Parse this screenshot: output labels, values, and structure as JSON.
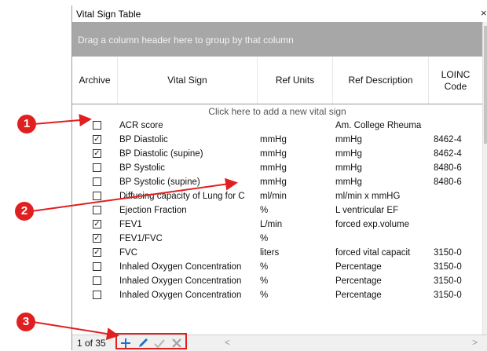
{
  "window": {
    "title": "Vital Sign Table",
    "close_glyph": "×"
  },
  "group_area": {
    "text": "Drag a column header here to group by that column"
  },
  "columns": [
    "Archive",
    "Vital Sign",
    "Ref Units",
    "Ref Description",
    "LOINC\nCode"
  ],
  "add_row_text": "Click here to add a new vital sign",
  "rows": [
    {
      "checked": false,
      "name": "ACR score",
      "units": "",
      "desc": "Am. College Rheuma",
      "loinc": ""
    },
    {
      "checked": true,
      "name": "BP Diastolic",
      "units": "mmHg",
      "desc": "mmHg",
      "loinc": "8462-4"
    },
    {
      "checked": true,
      "name": "BP Diastolic (supine)",
      "units": "mmHg",
      "desc": "mmHg",
      "loinc": "8462-4"
    },
    {
      "checked": false,
      "name": "BP Systolic",
      "units": "mmHg",
      "desc": "mmHg",
      "loinc": "8480-6"
    },
    {
      "checked": false,
      "name": "BP Systolic  (supine)",
      "units": "mmHg",
      "desc": "mmHg",
      "loinc": "8480-6"
    },
    {
      "checked": false,
      "name": "Diffusing capacity of Lung for C",
      "units": "ml/min",
      "desc": "ml/min x mmHG",
      "loinc": ""
    },
    {
      "checked": false,
      "name": "Ejection Fraction",
      "units": "%",
      "desc": "L ventricular EF",
      "loinc": ""
    },
    {
      "checked": true,
      "name": "FEV1",
      "units": "L/min",
      "desc": "forced exp.volume",
      "loinc": ""
    },
    {
      "checked": true,
      "name": "FEV1/FVC",
      "units": "%",
      "desc": "",
      "loinc": ""
    },
    {
      "checked": true,
      "name": "FVC",
      "units": "liters",
      "desc": "forced vital capacit",
      "loinc": "3150-0"
    },
    {
      "checked": false,
      "name": "Inhaled Oxygen Concentration",
      "units": "%",
      "desc": "Percentage",
      "loinc": "3150-0"
    },
    {
      "checked": false,
      "name": "Inhaled Oxygen Concentration",
      "units": "%",
      "desc": "Percentage",
      "loinc": "3150-0"
    },
    {
      "checked": false,
      "name": "Inhaled Oxygen Concentration",
      "units": "%",
      "desc": "Percentage",
      "loinc": "3150-0"
    }
  ],
  "footer": {
    "pager_text": "1 of 35"
  },
  "callouts": [
    "1",
    "2",
    "3"
  ],
  "colors": {
    "callout": "#e02020",
    "add_icon": "#1f6fc8",
    "group_area": "#a7a7a7"
  },
  "toolbar_icons": [
    "plus-icon",
    "pencil-icon",
    "check-icon",
    "x-icon"
  ]
}
